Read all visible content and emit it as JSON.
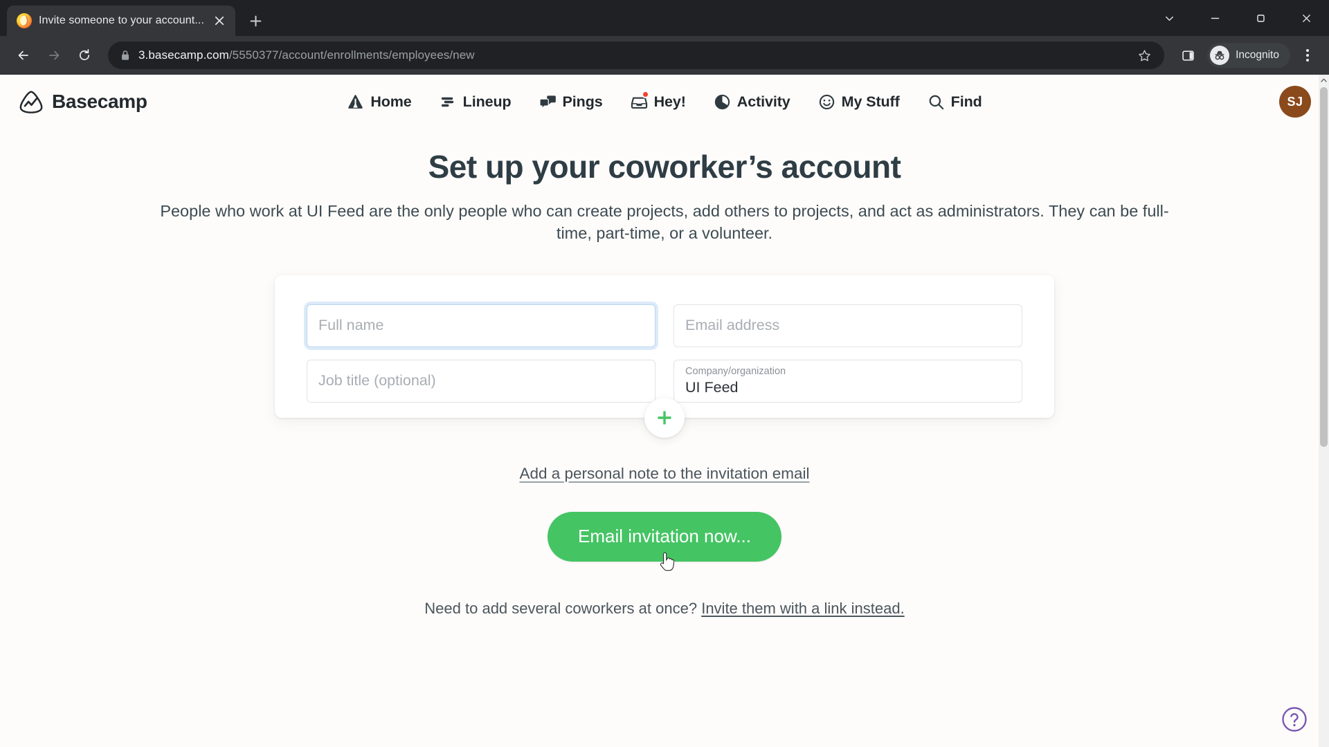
{
  "browser": {
    "tab": {
      "title": "Invite someone to your account...",
      "favicon": "basecamp-favicon",
      "close_label": "Close tab"
    },
    "new_tab_label": "New tab",
    "window_controls": {
      "minimize": "Minimize",
      "maximize": "Restore",
      "close": "Close",
      "more": "Search tabs"
    },
    "nav": {
      "back": "Back",
      "forward": "Forward",
      "reload": "Reload"
    },
    "omnibox": {
      "url_host": "3.basecamp.com",
      "url_path": "/5550377/account/enrollments/employees/new",
      "security": "secure-lock",
      "bookmark_label": "Bookmark this tab"
    },
    "toolbar": {
      "side_panel_label": "Side panel",
      "incognito_label": "Incognito",
      "menu_label": "Customize and control Google Chrome"
    }
  },
  "app": {
    "logo_text": "Basecamp",
    "nav_items": [
      {
        "label": "Home",
        "icon": "tent-icon",
        "badge": false
      },
      {
        "label": "Lineup",
        "icon": "lineup-icon",
        "badge": false
      },
      {
        "label": "Pings",
        "icon": "chat-icon",
        "badge": false
      },
      {
        "label": "Hey!",
        "icon": "inbox-icon",
        "badge": true
      },
      {
        "label": "Activity",
        "icon": "pie-icon",
        "badge": false
      },
      {
        "label": "My Stuff",
        "icon": "smiley-icon",
        "badge": false
      },
      {
        "label": "Find",
        "icon": "search-icon",
        "badge": false
      }
    ],
    "avatar_initials": "SJ",
    "avatar_color": "#8a4a1c"
  },
  "main": {
    "title": "Set up your coworker’s account",
    "description": "People who work at UI Feed are the only people who can create projects, add others to projects, and act as administrators. They can be full-time, part-time, or a volunteer.",
    "form": {
      "full_name": {
        "placeholder": "Full name",
        "value": "",
        "focused": true
      },
      "email": {
        "placeholder": "Email address",
        "value": "",
        "focused": false
      },
      "job_title": {
        "placeholder": "Job title (optional)",
        "value": "",
        "focused": false
      },
      "company": {
        "label": "Company/organization",
        "value": "UI Feed",
        "focused": false
      },
      "add_another_label": "Add another person"
    },
    "personal_note_link": "Add a personal note to the invitation email",
    "submit_label": "Email invitation now...",
    "footer_prefix": "Need to add several coworkers at once?",
    "footer_link": "Invite them with a link instead.",
    "help_label": "Help"
  },
  "colors": {
    "accent_green": "#45c464",
    "badge_red": "#f4412c",
    "help_purple": "#7a57b5",
    "heading": "#2f3d45"
  }
}
